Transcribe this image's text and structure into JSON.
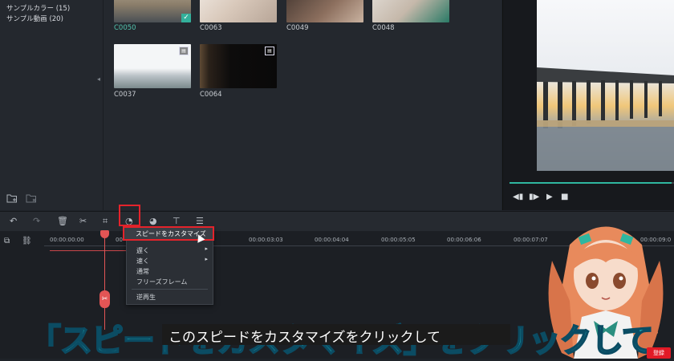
{
  "library": {
    "items": [
      "サンプルカラー (15)",
      "サンプル動画 (20)"
    ]
  },
  "media": {
    "clips": [
      {
        "label": "C0050",
        "selected": true
      },
      {
        "label": "C0063",
        "selected": false
      },
      {
        "label": "C0049",
        "selected": false
      },
      {
        "label": "C0048",
        "selected": false
      },
      {
        "label": "C0037",
        "selected": false
      },
      {
        "label": "C0064",
        "selected": false
      }
    ]
  },
  "preview": {
    "progress": 0.98,
    "accent": "#2fb7a0"
  },
  "toolbar": {
    "icons": [
      "undo-icon",
      "redo-icon",
      "delete-icon",
      "cut-icon",
      "crop-icon",
      "speed-icon",
      "color-icon",
      "text-icon",
      "audio-mixer-icon"
    ]
  },
  "timeline": {
    "timecodes": [
      "00:00:00:00",
      "00",
      "00:00:03:03",
      "00:00:04:04",
      "00:00:05:05",
      "00:00:06:06",
      "00:00:07:07",
      "00:00:09:0"
    ]
  },
  "context_menu": {
    "customize_speed": "スピードをカスタマイズ",
    "slow": "遅く",
    "fast": "速く",
    "normal": "通常",
    "freeze_frame": "フリーズフレーム",
    "reverse": "逆再生"
  },
  "captions": {
    "big": "「スピードをカスタマイズ」をクリックして",
    "subtitle": "このスピードをカスタマイズをクリックして"
  },
  "subscribe_label": "登録"
}
